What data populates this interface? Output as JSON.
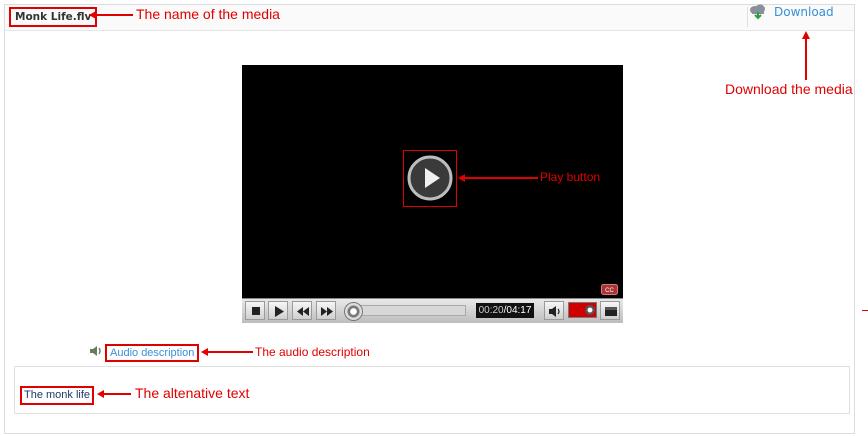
{
  "media": {
    "name": "Monk Life.flv"
  },
  "download": {
    "label": "Download",
    "icon": "cloud-download-icon"
  },
  "player": {
    "play_icon": "play-icon",
    "cc_label": "CC",
    "time": {
      "current": "00:20",
      "separator": "/",
      "total": "04:17"
    },
    "progress": 0.08,
    "volume_level": 0.85
  },
  "audio_description": {
    "label": "Audio description",
    "icon": "audio-icon"
  },
  "alternative_text": {
    "text": "The monk life"
  },
  "annotations": {
    "media_name": "The name of the media",
    "download": "Download the media",
    "play": "Play button",
    "audio_description": "The audio description",
    "alt_text": "The altenative text"
  },
  "colors": {
    "annotation": "#e00000",
    "link": "#3a8fd6"
  }
}
